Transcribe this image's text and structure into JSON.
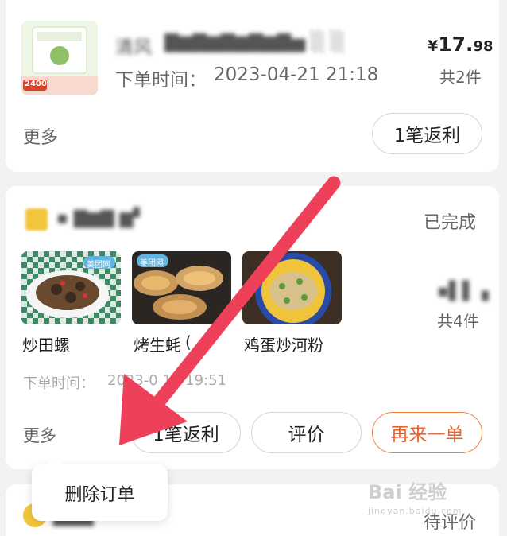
{
  "order1": {
    "title": "清风",
    "order_time_label": "下单时间：",
    "order_time": "2023-04-21 21:18",
    "price_currency": "¥",
    "price_main": "17.",
    "price_decimal": "98",
    "item_count": "共2件",
    "more_label": "更多",
    "rebate_button": "1笔返利",
    "thumb_badge": "2400"
  },
  "order2": {
    "status": "已完成",
    "items": [
      {
        "name": "炒田螺"
      },
      {
        "name": "烤生蚝"
      },
      {
        "name": "鸡蛋炒河粉"
      }
    ],
    "item_count": "共4件",
    "order_time_label": "下单时间：",
    "order_time": "2023-0 19 19:51",
    "more_label": "更多",
    "rebate_button": "1笔返利",
    "review_button": "评价",
    "reorder_button": "再来一单",
    "thumb_tag": "美团网"
  },
  "order3": {
    "status": "待评价"
  },
  "popup": {
    "delete_label": "删除订单"
  },
  "watermark": {
    "main": "Bai 经验",
    "sub": "jingyan.baidu.com"
  },
  "colors": {
    "accent_orange": "#f0622a",
    "arrow": "#ee4159",
    "card_bg": "#ffffff",
    "page_bg": "#f2f2f2"
  }
}
